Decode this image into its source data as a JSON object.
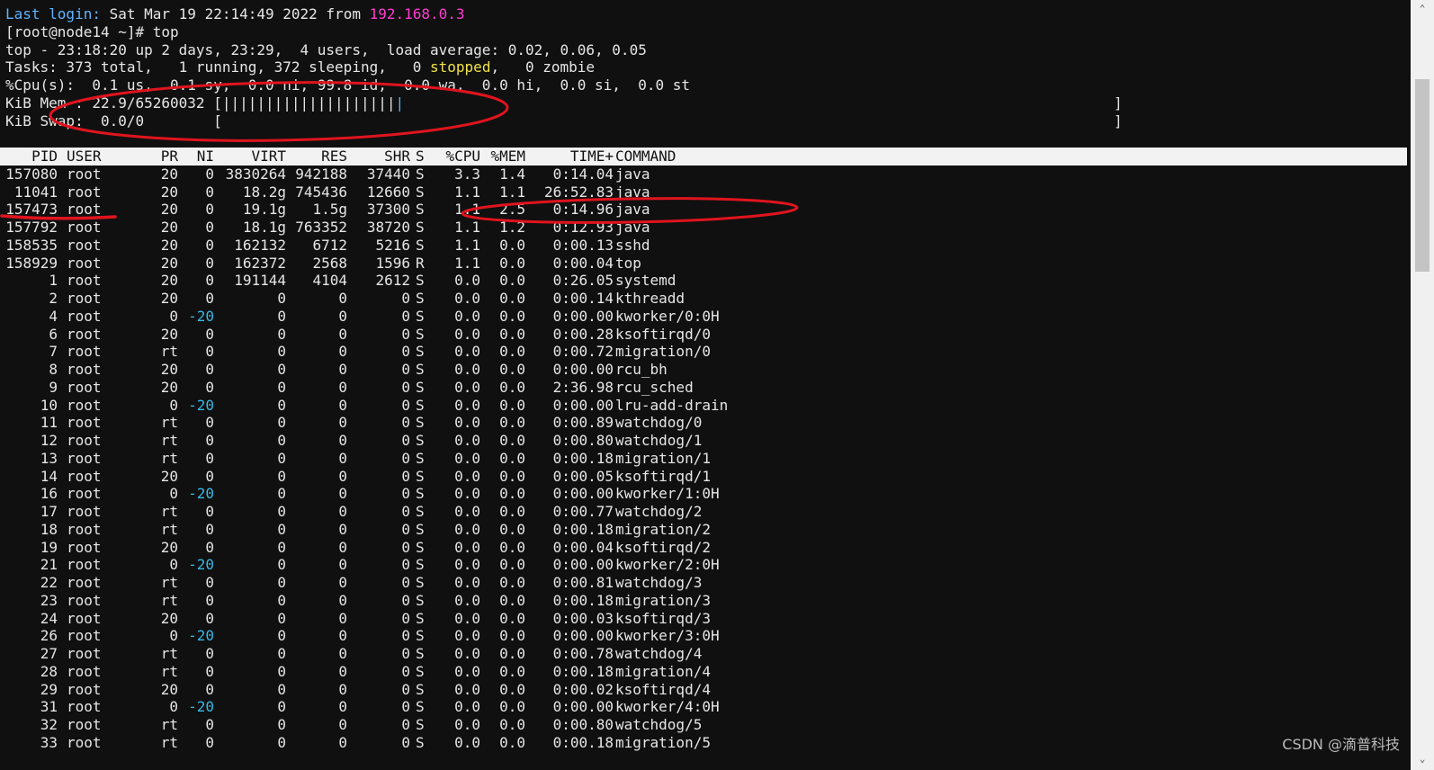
{
  "login": {
    "prefix": "Last login:",
    "date": " Sat Mar 19 22:14:49 2022 from ",
    "ip": "192.168.0.3"
  },
  "prompt": "[root@node14 ~]# top",
  "summary": {
    "uptime": "top - 23:18:20 up 2 days, 23:29,  4 users,  load average: 0.02, 0.06, 0.05",
    "tasks_a": "Tasks: 373 total,   1 running, 372 sleeping,   0 ",
    "tasks_stopped": "stopped",
    "tasks_b": ",   0 zombie",
    "cpu": "%Cpu(s):  0.1 us,  0.1 sy,  0.0 ni, 99.8 id,  0.0 wa,  0.0 hi,  0.0 si,  0.0 st",
    "mem": "KiB Mem : 22.9/65260032 [||||||||||||||||||||",
    "mem_bar_tail": "|",
    "mem_end": "]",
    "swap": "KiB Swap:  0.0/0        [",
    "swap_end": "]"
  },
  "columns": [
    "PID",
    "USER",
    "PR",
    "NI",
    "VIRT",
    "RES",
    "SHR",
    "S",
    "%CPU",
    "%MEM",
    "TIME+",
    "COMMAND"
  ],
  "processes": [
    [
      "157080",
      "root",
      "20",
      "0",
      "3830264",
      "942188",
      "37440",
      "S",
      "3.3",
      "1.4",
      "0:14.04",
      "java"
    ],
    [
      "11041",
      "root",
      "20",
      "0",
      "18.2g",
      "745436",
      "12660",
      "S",
      "1.1",
      "1.1",
      "26:52.83",
      "java"
    ],
    [
      "157473",
      "root",
      "20",
      "0",
      "19.1g",
      "1.5g",
      "37300",
      "S",
      "1.1",
      "2.5",
      "0:14.96",
      "java"
    ],
    [
      "157792",
      "root",
      "20",
      "0",
      "18.1g",
      "763352",
      "38720",
      "S",
      "1.1",
      "1.2",
      "0:12.93",
      "java"
    ],
    [
      "158535",
      "root",
      "20",
      "0",
      "162132",
      "6712",
      "5216",
      "S",
      "1.1",
      "0.0",
      "0:00.13",
      "sshd"
    ],
    [
      "158929",
      "root",
      "20",
      "0",
      "162372",
      "2568",
      "1596",
      "R",
      "1.1",
      "0.0",
      "0:00.04",
      "top"
    ],
    [
      "1",
      "root",
      "20",
      "0",
      "191144",
      "4104",
      "2612",
      "S",
      "0.0",
      "0.0",
      "0:26.05",
      "systemd"
    ],
    [
      "2",
      "root",
      "20",
      "0",
      "0",
      "0",
      "0",
      "S",
      "0.0",
      "0.0",
      "0:00.14",
      "kthreadd"
    ],
    [
      "4",
      "root",
      "0",
      "-20",
      "0",
      "0",
      "0",
      "S",
      "0.0",
      "0.0",
      "0:00.00",
      "kworker/0:0H"
    ],
    [
      "6",
      "root",
      "20",
      "0",
      "0",
      "0",
      "0",
      "S",
      "0.0",
      "0.0",
      "0:00.28",
      "ksoftirqd/0"
    ],
    [
      "7",
      "root",
      "rt",
      "0",
      "0",
      "0",
      "0",
      "S",
      "0.0",
      "0.0",
      "0:00.72",
      "migration/0"
    ],
    [
      "8",
      "root",
      "20",
      "0",
      "0",
      "0",
      "0",
      "S",
      "0.0",
      "0.0",
      "0:00.00",
      "rcu_bh"
    ],
    [
      "9",
      "root",
      "20",
      "0",
      "0",
      "0",
      "0",
      "S",
      "0.0",
      "0.0",
      "2:36.98",
      "rcu_sched"
    ],
    [
      "10",
      "root",
      "0",
      "-20",
      "0",
      "0",
      "0",
      "S",
      "0.0",
      "0.0",
      "0:00.00",
      "lru-add-drain"
    ],
    [
      "11",
      "root",
      "rt",
      "0",
      "0",
      "0",
      "0",
      "S",
      "0.0",
      "0.0",
      "0:00.89",
      "watchdog/0"
    ],
    [
      "12",
      "root",
      "rt",
      "0",
      "0",
      "0",
      "0",
      "S",
      "0.0",
      "0.0",
      "0:00.80",
      "watchdog/1"
    ],
    [
      "13",
      "root",
      "rt",
      "0",
      "0",
      "0",
      "0",
      "S",
      "0.0",
      "0.0",
      "0:00.18",
      "migration/1"
    ],
    [
      "14",
      "root",
      "20",
      "0",
      "0",
      "0",
      "0",
      "S",
      "0.0",
      "0.0",
      "0:00.05",
      "ksoftirqd/1"
    ],
    [
      "16",
      "root",
      "0",
      "-20",
      "0",
      "0",
      "0",
      "S",
      "0.0",
      "0.0",
      "0:00.00",
      "kworker/1:0H"
    ],
    [
      "17",
      "root",
      "rt",
      "0",
      "0",
      "0",
      "0",
      "S",
      "0.0",
      "0.0",
      "0:00.77",
      "watchdog/2"
    ],
    [
      "18",
      "root",
      "rt",
      "0",
      "0",
      "0",
      "0",
      "S",
      "0.0",
      "0.0",
      "0:00.18",
      "migration/2"
    ],
    [
      "19",
      "root",
      "20",
      "0",
      "0",
      "0",
      "0",
      "S",
      "0.0",
      "0.0",
      "0:00.04",
      "ksoftirqd/2"
    ],
    [
      "21",
      "root",
      "0",
      "-20",
      "0",
      "0",
      "0",
      "S",
      "0.0",
      "0.0",
      "0:00.00",
      "kworker/2:0H"
    ],
    [
      "22",
      "root",
      "rt",
      "0",
      "0",
      "0",
      "0",
      "S",
      "0.0",
      "0.0",
      "0:00.81",
      "watchdog/3"
    ],
    [
      "23",
      "root",
      "rt",
      "0",
      "0",
      "0",
      "0",
      "S",
      "0.0",
      "0.0",
      "0:00.18",
      "migration/3"
    ],
    [
      "24",
      "root",
      "20",
      "0",
      "0",
      "0",
      "0",
      "S",
      "0.0",
      "0.0",
      "0:00.03",
      "ksoftirqd/3"
    ],
    [
      "26",
      "root",
      "0",
      "-20",
      "0",
      "0",
      "0",
      "S",
      "0.0",
      "0.0",
      "0:00.00",
      "kworker/3:0H"
    ],
    [
      "27",
      "root",
      "rt",
      "0",
      "0",
      "0",
      "0",
      "S",
      "0.0",
      "0.0",
      "0:00.78",
      "watchdog/4"
    ],
    [
      "28",
      "root",
      "rt",
      "0",
      "0",
      "0",
      "0",
      "S",
      "0.0",
      "0.0",
      "0:00.18",
      "migration/4"
    ],
    [
      "29",
      "root",
      "20",
      "0",
      "0",
      "0",
      "0",
      "S",
      "0.0",
      "0.0",
      "0:00.02",
      "ksoftirqd/4"
    ],
    [
      "31",
      "root",
      "0",
      "-20",
      "0",
      "0",
      "0",
      "S",
      "0.0",
      "0.0",
      "0:00.00",
      "kworker/4:0H"
    ],
    [
      "32",
      "root",
      "rt",
      "0",
      "0",
      "0",
      "0",
      "S",
      "0.0",
      "0.0",
      "0:00.80",
      "watchdog/5"
    ],
    [
      "33",
      "root",
      "rt",
      "0",
      "0",
      "0",
      "0",
      "S",
      "0.0",
      "0.0",
      "0:00.18",
      "migration/5"
    ]
  ],
  "watermark": "CSDN @滴普科技",
  "colors": {
    "background": "#101010",
    "text": "#e6e6e6",
    "login_label": "#5fb3ff",
    "ip": "#ff3ccf",
    "stopped": "#f2e24a",
    "negative_nice": "#38b8e8",
    "annotation": "#e0141e"
  },
  "scrollbar": {
    "up_icon": "⌃",
    "down_icon": "⌄"
  }
}
